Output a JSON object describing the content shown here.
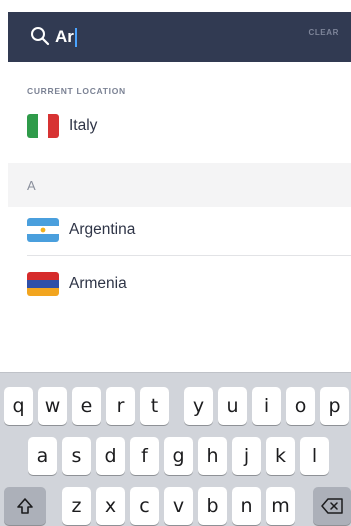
{
  "search": {
    "query": "Ar",
    "clear_label": "CLEAR"
  },
  "current_location": {
    "section_label": "CURRENT LOCATION",
    "country": "Italy"
  },
  "results": {
    "letter": "A",
    "items": [
      {
        "name": "Argentina",
        "flag_icon": "argentina-flag-icon"
      },
      {
        "name": "Armenia",
        "flag_icon": "armenia-flag-icon"
      }
    ]
  },
  "keyboard": {
    "row1": [
      "q",
      "w",
      "e",
      "r",
      "t",
      "y",
      "u",
      "i",
      "o",
      "p"
    ],
    "row2": [
      "a",
      "s",
      "d",
      "f",
      "g",
      "h",
      "j",
      "k",
      "l"
    ],
    "row3": [
      "z",
      "x",
      "c",
      "v",
      "b",
      "n",
      "m"
    ],
    "shift_icon": "shift-icon",
    "delete_icon": "delete-icon"
  },
  "colors": {
    "header_bg": "#313a52",
    "caret": "#4aa3ff",
    "keyboard_bg": "#d1d4da"
  }
}
